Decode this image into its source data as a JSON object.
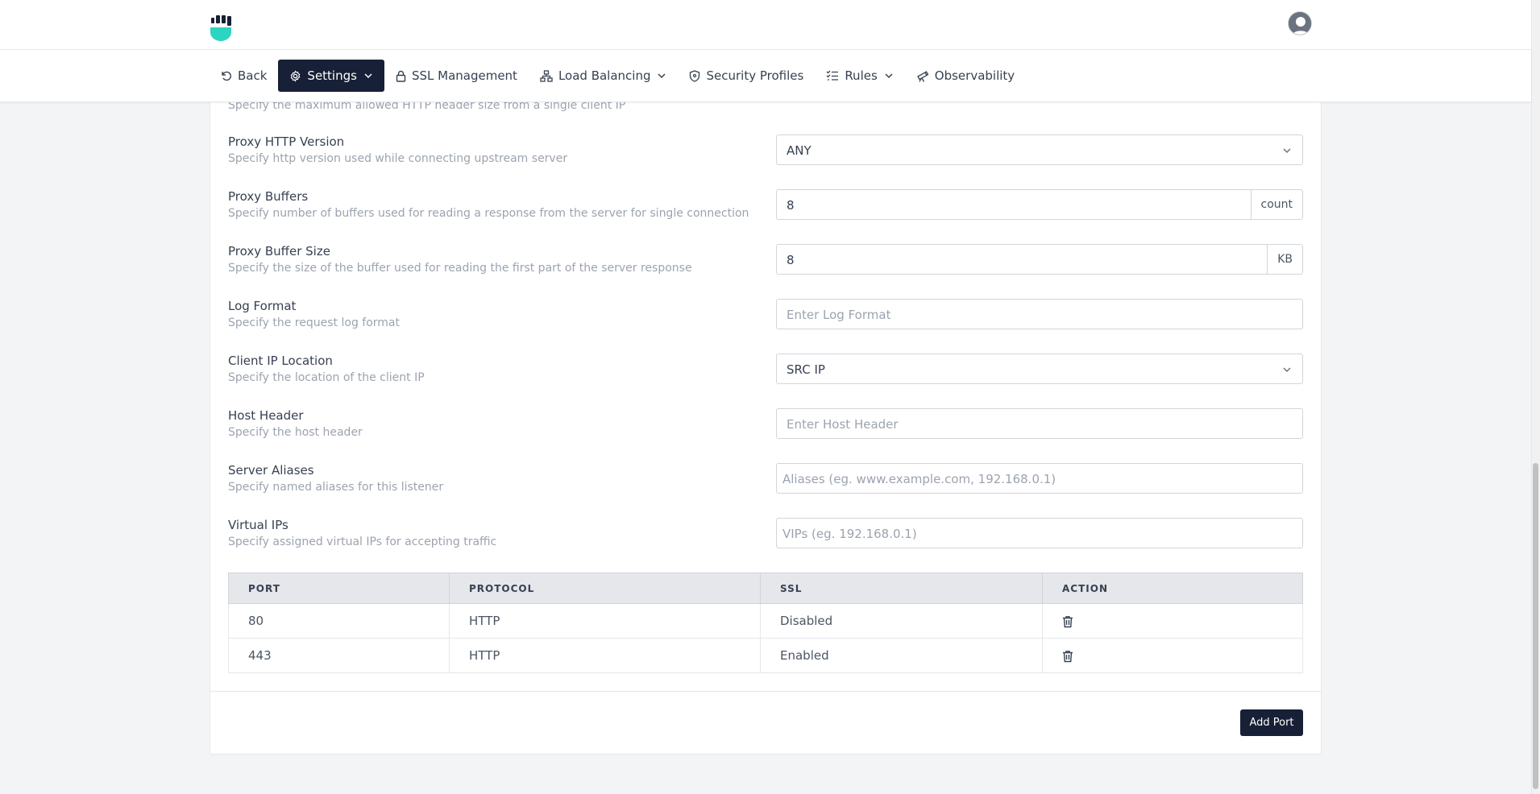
{
  "nav": {
    "back": "Back",
    "settings": "Settings",
    "ssl": "SSL Management",
    "load_balancing": "Load Balancing",
    "security_profiles": "Security Profiles",
    "rules": "Rules",
    "observability": "Observability"
  },
  "partial_row": {
    "description": "Specify the maximum allowed HTTP header size from a single client IP"
  },
  "fields": {
    "proxy_http_version": {
      "label": "Proxy HTTP Version",
      "description": "Specify http version used while connecting upstream server",
      "value": "ANY"
    },
    "proxy_buffers": {
      "label": "Proxy Buffers",
      "description": "Specify number of buffers used for reading a response from the server for single connection",
      "value": "8",
      "unit": "count"
    },
    "proxy_buffer_size": {
      "label": "Proxy Buffer Size",
      "description": "Specify the size of the buffer used for reading the first part of the server response",
      "value": "8",
      "unit": "KB"
    },
    "log_format": {
      "label": "Log Format",
      "description": "Specify the request log format",
      "placeholder": "Enter Log Format"
    },
    "client_ip_location": {
      "label": "Client IP Location",
      "description": "Specify the location of the client IP",
      "value": "SRC IP"
    },
    "host_header": {
      "label": "Host Header",
      "description": "Specify the host header",
      "placeholder": "Enter Host Header"
    },
    "server_aliases": {
      "label": "Server Aliases",
      "description": "Specify named aliases for this listener",
      "placeholder": "Aliases (eg. www.example.com, 192.168.0.1)"
    },
    "virtual_ips": {
      "label": "Virtual IPs",
      "description": "Specify assigned virtual IPs for accepting traffic",
      "placeholder": "VIPs (eg. 192.168.0.1)"
    }
  },
  "ports_table": {
    "headers": [
      "PORT",
      "PROTOCOL",
      "SSL",
      "ACTION"
    ],
    "rows": [
      {
        "port": "80",
        "protocol": "HTTP",
        "ssl": "Disabled"
      },
      {
        "port": "443",
        "protocol": "HTTP",
        "ssl": "Enabled"
      }
    ]
  },
  "add_port_label": "Add Port",
  "icons": {
    "back": "undo-icon",
    "settings": "gear-icon",
    "ssl": "lock-icon",
    "load_balancing": "network-icon",
    "security": "shield-icon",
    "rules": "list-check-icon",
    "observability": "telescope-icon",
    "delete": "trash-icon"
  },
  "colors": {
    "primary": "#172036",
    "brand": "#2dd4bf"
  }
}
